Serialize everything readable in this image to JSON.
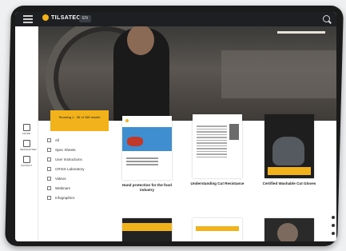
{
  "header": {
    "brand": "TILSATEC",
    "language": "EN"
  },
  "sidebar": [
    {
      "label": "FILTER"
    },
    {
      "label": "NEWSLETTER"
    },
    {
      "label": "CONTACT"
    }
  ],
  "showing": {
    "text": "Showing 1 - 36 of 168 results"
  },
  "filters": [
    {
      "label": "All"
    },
    {
      "label": "Spec Sheets"
    },
    {
      "label": "User Instructions"
    },
    {
      "label": "CRISS Laboratory"
    },
    {
      "label": "Videos"
    },
    {
      "label": "Webinars"
    },
    {
      "label": "Infographics"
    }
  ],
  "cards": [
    {
      "title": "Hand protection for the food industry"
    },
    {
      "title": "Understanding Cut Resistance"
    },
    {
      "title": "Certified Washable Cut Gloves"
    }
  ]
}
